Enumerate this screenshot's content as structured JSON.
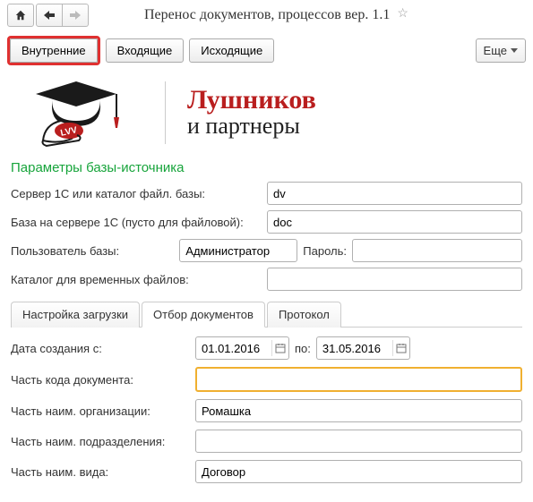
{
  "header": {
    "title": "Перенос документов, процессов вер. 1.1"
  },
  "main_tabs": {
    "internal": "Внутренние",
    "incoming": "Входящие",
    "outgoing": "Исходящие",
    "more": "Еще"
  },
  "brand": {
    "line1": "Лушников",
    "line2": "и партнеры",
    "badge": "LVV"
  },
  "section": {
    "title": "Параметры базы-источника"
  },
  "form": {
    "server_label": "Сервер 1С или каталог файл. базы:",
    "server_value": "dv",
    "base_label": "База на сервере 1С (пусто для файловой):",
    "base_value": "doc",
    "user_label": "Пользователь базы:",
    "user_value": "Администратор",
    "pass_label": "Пароль:",
    "pass_value": "",
    "tmp_label": "Каталог для временных файлов:",
    "tmp_value": ""
  },
  "sub_tabs": {
    "t1": "Настройка загрузки",
    "t2": "Отбор документов",
    "t3": "Протокол"
  },
  "filter": {
    "date_from_label": "Дата создания с:",
    "date_from": "01.01.2016",
    "date_to_label": "по:",
    "date_to": "31.05.2016",
    "doc_code_label": "Часть кода документа:",
    "doc_code_value": "",
    "org_label": "Часть наим. организации:",
    "org_value": "Ромашка",
    "dept_label": "Часть наим. подразделения:",
    "dept_value": "",
    "kind_label": "Часть наим. вида:",
    "kind_value": "Договор"
  }
}
